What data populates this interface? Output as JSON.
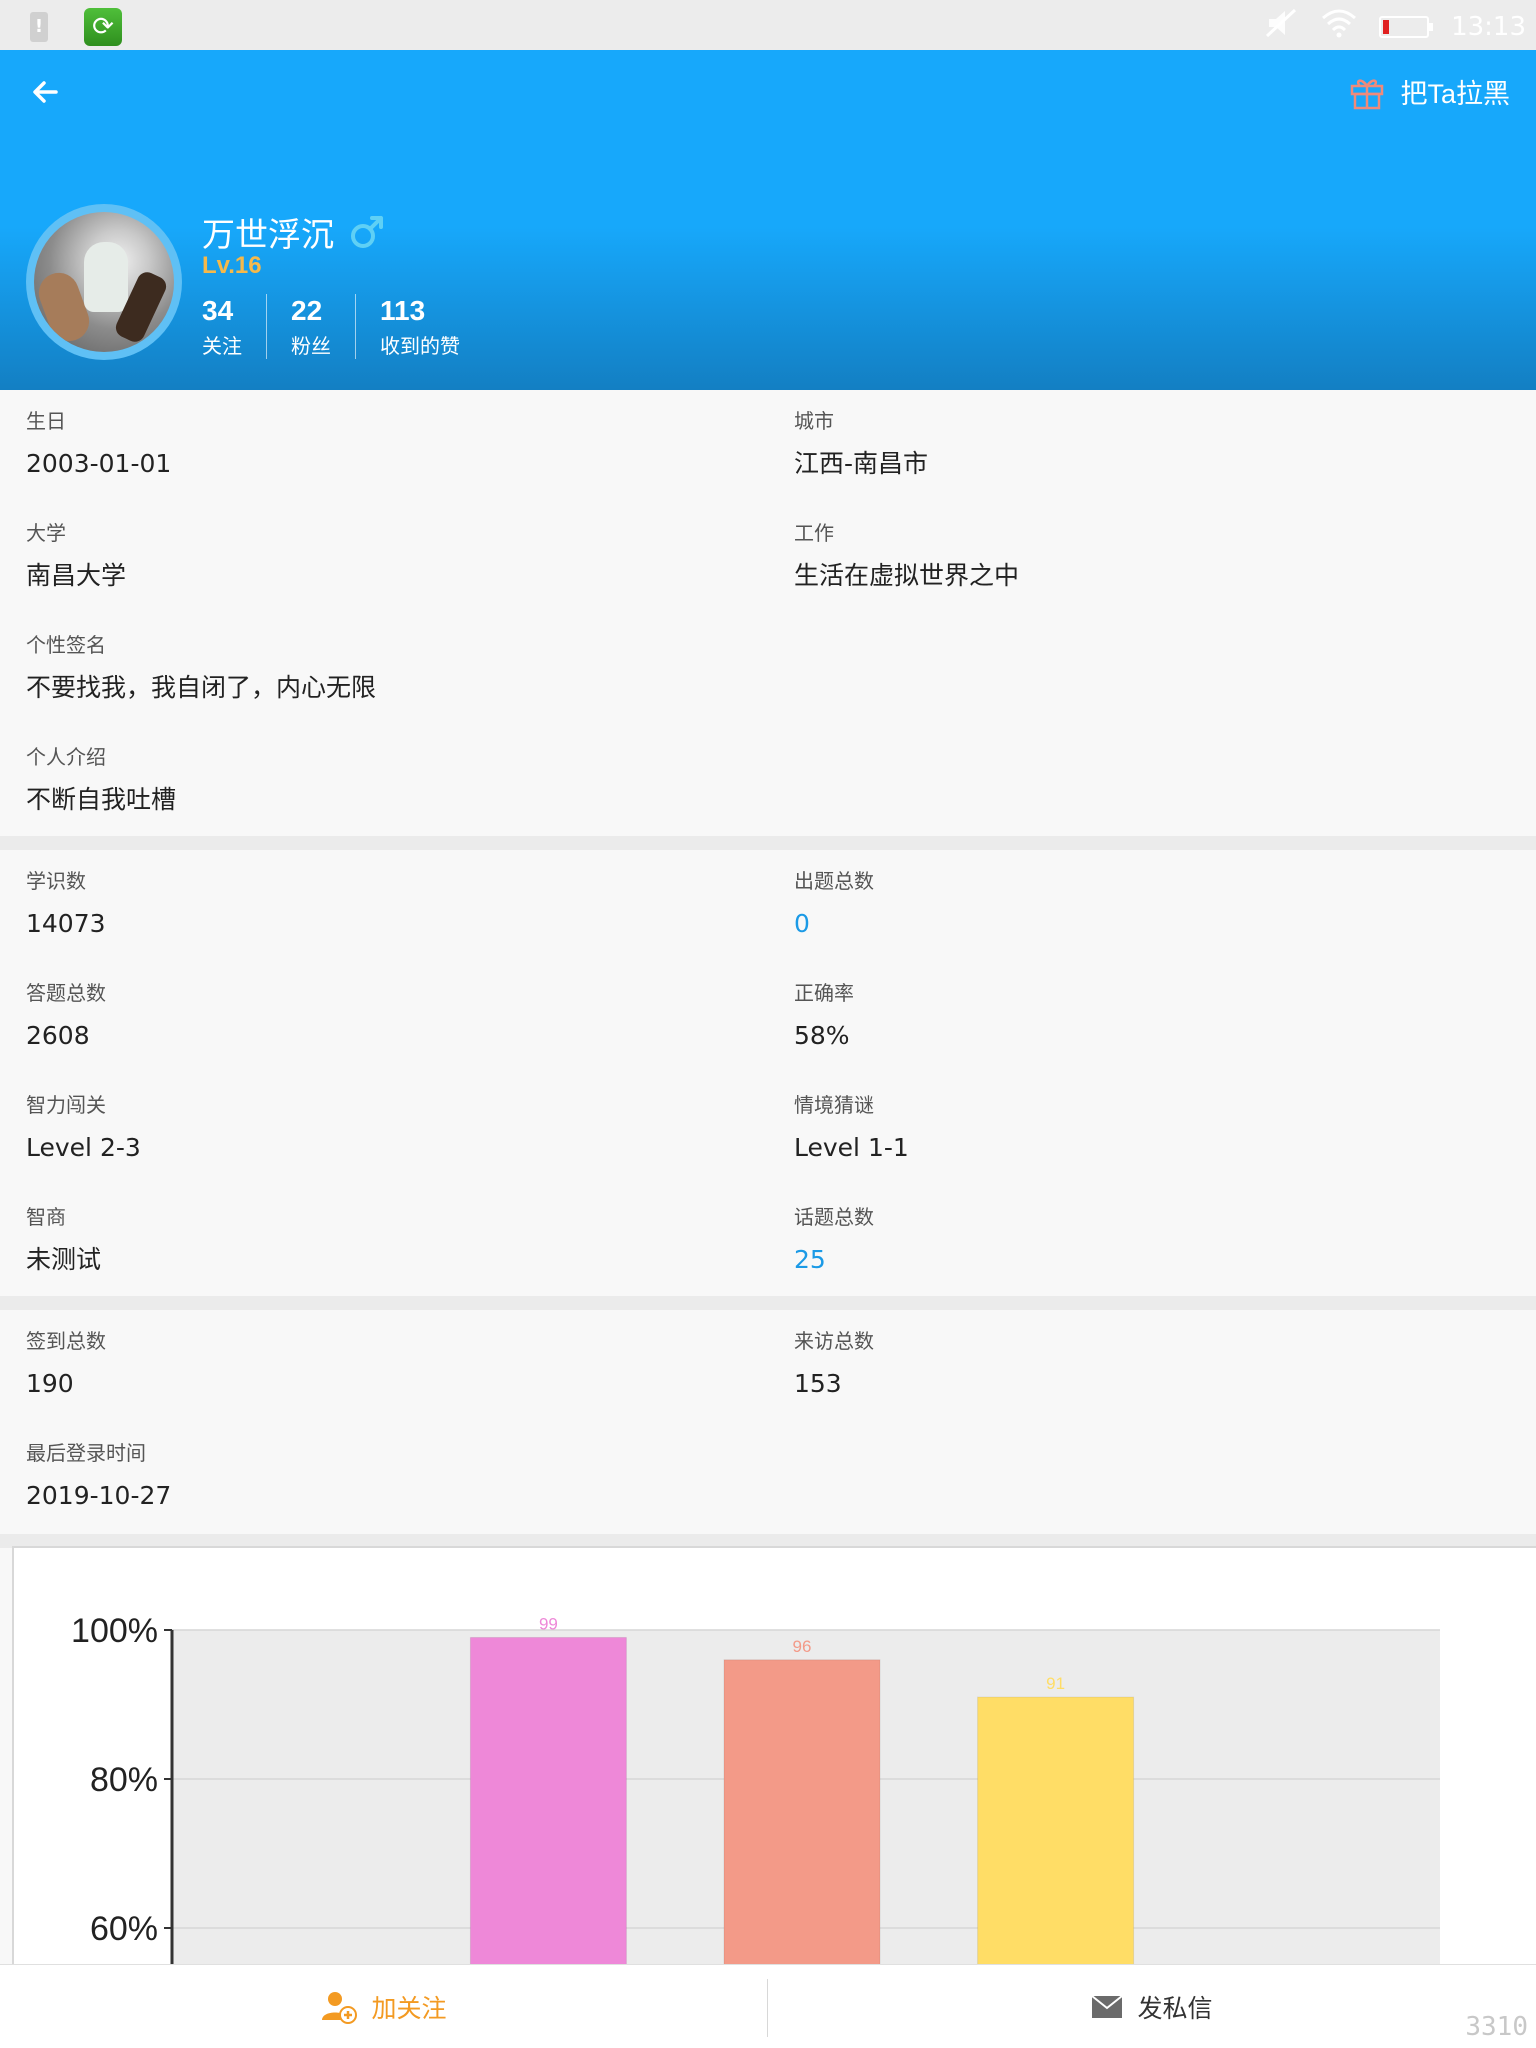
{
  "status_bar": {
    "time": "13:13"
  },
  "header": {
    "block_label": "把Ta拉黑",
    "username": "万世浮沉",
    "gender": "male",
    "level": "Lv.16",
    "stats": [
      {
        "value": "34",
        "label": "关注"
      },
      {
        "value": "22",
        "label": "粉丝"
      },
      {
        "value": "113",
        "label": "收到的赞"
      }
    ]
  },
  "profile": {
    "birthday": {
      "label": "生日",
      "value": "2003-01-01"
    },
    "city": {
      "label": "城市",
      "value": "江西-南昌市"
    },
    "university": {
      "label": "大学",
      "value": "南昌大学"
    },
    "job": {
      "label": "工作",
      "value": "生活在虚拟世界之中"
    },
    "signature": {
      "label": "个性签名",
      "value": "不要找我，我自闭了，内心无限"
    },
    "intro": {
      "label": "个人介绍",
      "value": "不断自我吐槽"
    }
  },
  "stats_section": {
    "knowledge": {
      "label": "学识数",
      "value": "14073"
    },
    "questions_created": {
      "label": "出题总数",
      "value": "0"
    },
    "answers": {
      "label": "答题总数",
      "value": "2608"
    },
    "accuracy": {
      "label": "正确率",
      "value": "58%"
    },
    "puzzle": {
      "label": "智力闯关",
      "value": "Level  2-3"
    },
    "riddle": {
      "label": "情境猜谜",
      "value": "Level  1-1"
    },
    "iq": {
      "label": "智商",
      "value": "未测试"
    },
    "topics": {
      "label": "话题总数",
      "value": "25"
    }
  },
  "activity": {
    "checkins": {
      "label": "签到总数",
      "value": "190"
    },
    "visits": {
      "label": "来访总数",
      "value": "153"
    },
    "last_login": {
      "label": "最后登录时间",
      "value": "2019-10-27"
    }
  },
  "chart_data": {
    "type": "bar",
    "categories": [
      "",
      "",
      "",
      "",
      ""
    ],
    "values": [
      null,
      99,
      96,
      91,
      null
    ],
    "data_labels": [
      "",
      "99",
      "96",
      "91",
      ""
    ],
    "colors": [
      "#ee88d8",
      "#f39a88",
      "#ffdd66"
    ],
    "yticks": [
      "60%",
      "80%",
      "100%"
    ],
    "ylim": [
      60,
      100
    ],
    "grid": true
  },
  "bottom_bar": {
    "follow_label": "加关注",
    "message_label": "发私信"
  },
  "watermark": "3310"
}
